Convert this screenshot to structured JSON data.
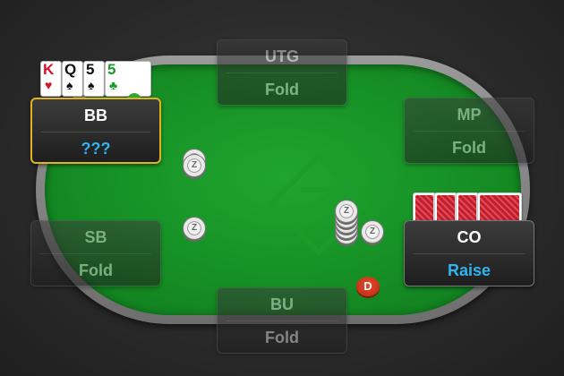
{
  "seats": {
    "utg": {
      "position": "UTG",
      "action": "Fold"
    },
    "mp": {
      "position": "MP",
      "action": "Fold"
    },
    "co": {
      "position": "CO",
      "action": "Raise"
    },
    "bu": {
      "position": "BU",
      "action": "Fold"
    },
    "sb": {
      "position": "SB",
      "action": "Fold"
    },
    "bb": {
      "position": "BB",
      "action": "???"
    }
  },
  "hero_cards": [
    {
      "rank": "K",
      "suit": "♥",
      "color": "red"
    },
    {
      "rank": "Q",
      "suit": "♠",
      "color": "black"
    },
    {
      "rank": "5",
      "suit": "♠",
      "color": "black"
    },
    {
      "rank": "5",
      "suit": "♣",
      "color": "green"
    }
  ],
  "dealer_button": {
    "label": "D"
  },
  "colors": {
    "felt": "#168f25",
    "highlight_border": "#e2b21a",
    "action_blue": "#2fb4f0",
    "card_back_red": "#c01f2e",
    "dealer_button": "#d3391c"
  }
}
